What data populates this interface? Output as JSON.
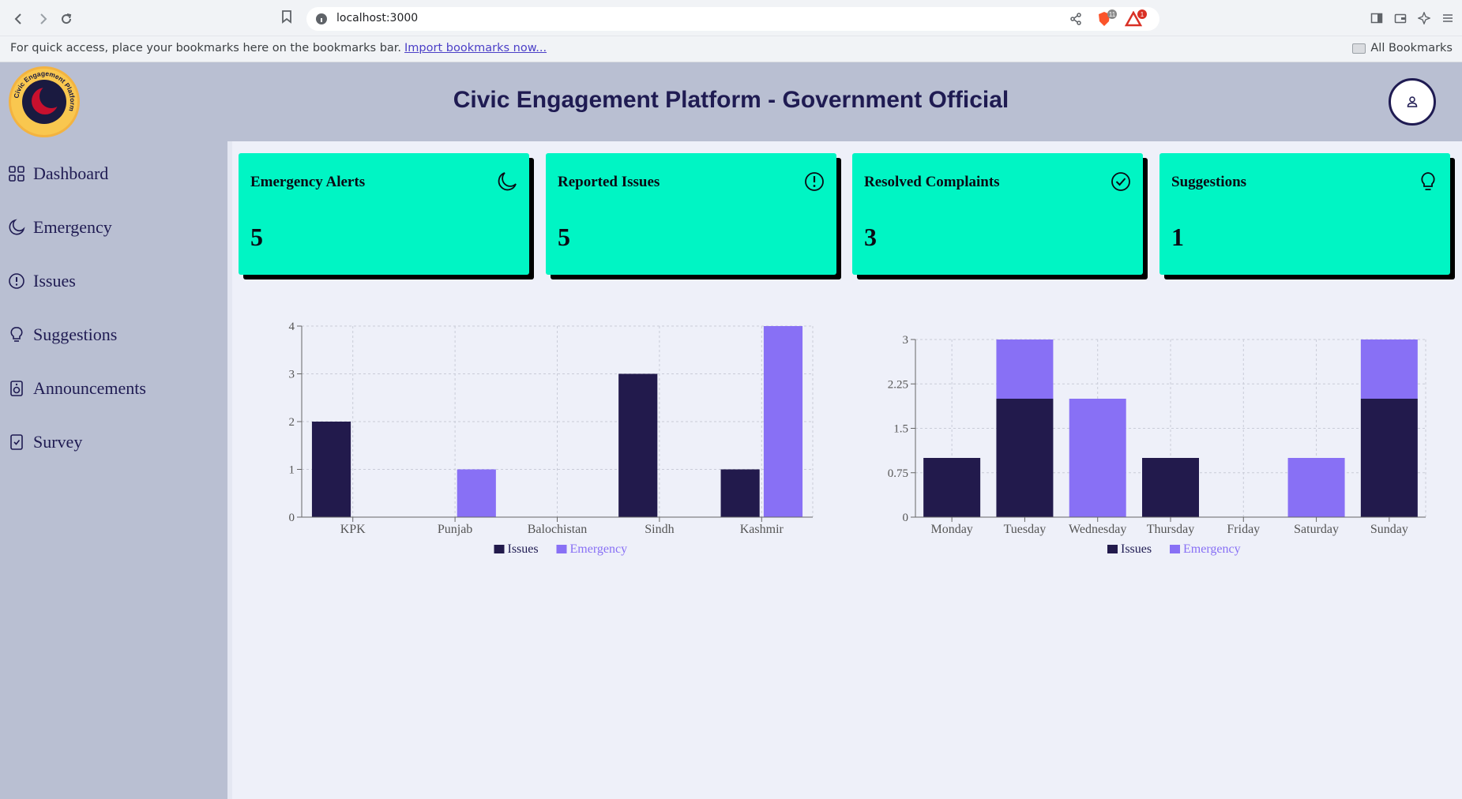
{
  "browser": {
    "url": "localhost:3000",
    "bookmarks_message": "For quick access, place your bookmarks here on the bookmarks bar.",
    "bookmarks_link": "Import bookmarks now...",
    "all_bookmarks": "All Bookmarks",
    "brave_badge": "11",
    "rewards_badge": "1"
  },
  "header": {
    "title": "Civic Engagement Platform - Government Official",
    "logo_text": "Civic Engagement Platform"
  },
  "sidebar": {
    "items": [
      {
        "label": "Dashboard",
        "icon": "grid-icon"
      },
      {
        "label": "Emergency",
        "icon": "moon-icon"
      },
      {
        "label": "Issues",
        "icon": "alert-circle-icon"
      },
      {
        "label": "Suggestions",
        "icon": "lightbulb-icon"
      },
      {
        "label": "Announcements",
        "icon": "speaker-icon"
      },
      {
        "label": "Survey",
        "icon": "clipboard-check-icon"
      }
    ]
  },
  "cards": [
    {
      "title": "Emergency Alerts",
      "value": "5",
      "icon": "moon-icon"
    },
    {
      "title": "Reported Issues",
      "value": "5",
      "icon": "alert-circle-icon"
    },
    {
      "title": "Resolved Complaints",
      "value": "3",
      "icon": "check-circle-icon"
    },
    {
      "title": "Suggestions",
      "value": "1",
      "icon": "lightbulb-icon"
    }
  ],
  "colors": {
    "issues": "#221a4c",
    "emergency": "#8870f5",
    "card_bg": "#00f5c4",
    "sidebar_bg": "#b9bfd2"
  },
  "chart_data": [
    {
      "type": "bar",
      "categories": [
        "KPK",
        "Punjab",
        "Balochistan",
        "Sindh",
        "Kashmir"
      ],
      "series": [
        {
          "name": "Issues",
          "values": [
            2,
            0,
            0,
            3,
            1
          ]
        },
        {
          "name": "Emergency",
          "values": [
            0,
            1,
            0,
            0,
            4
          ]
        }
      ],
      "ylim": [
        0,
        4
      ],
      "yticks": [
        "0",
        "1",
        "2",
        "3",
        "4"
      ],
      "grid": true,
      "legend": "bottom",
      "stacked": false
    },
    {
      "type": "bar",
      "categories": [
        "Monday",
        "Tuesday",
        "Wednesday",
        "Thursday",
        "Friday",
        "Saturday",
        "Sunday"
      ],
      "series": [
        {
          "name": "Issues",
          "values": [
            1,
            2,
            0,
            1,
            0,
            0,
            2
          ]
        },
        {
          "name": "Emergency",
          "values": [
            0,
            1,
            2,
            0,
            0,
            1,
            1
          ]
        }
      ],
      "ylim": [
        0,
        3
      ],
      "yticks": [
        "0",
        "0.75",
        "1.5",
        "2.25",
        "3"
      ],
      "grid": true,
      "legend": "bottom",
      "stacked": true
    }
  ]
}
